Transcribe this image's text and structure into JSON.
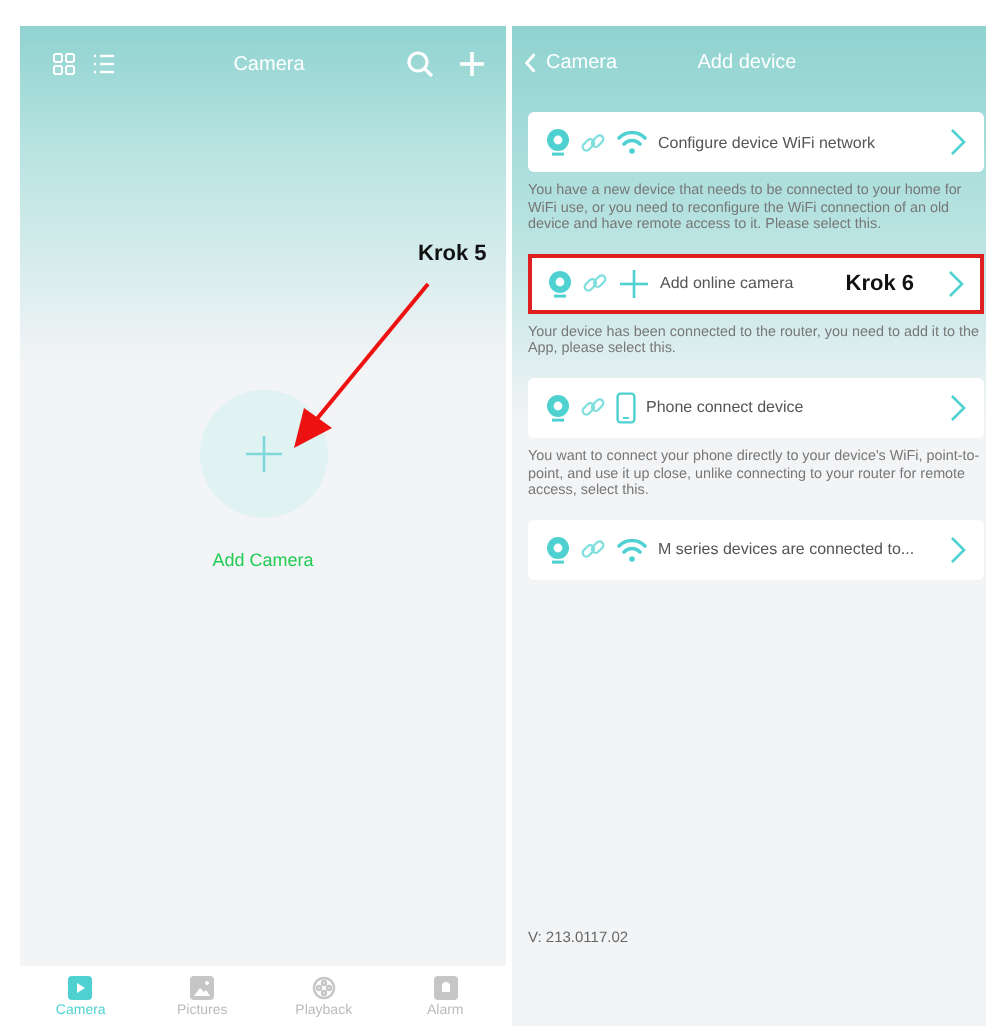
{
  "left_screen": {
    "header": {
      "title": "Camera"
    },
    "add_button": {
      "label": "Add Camera"
    },
    "annotation": {
      "label": "Krok 5"
    },
    "tab_bar": [
      {
        "label": "Camera",
        "kind": "play",
        "selected": true
      },
      {
        "label": "Pictures",
        "kind": "picture",
        "selected": false
      },
      {
        "label": "Playback",
        "kind": "reel",
        "selected": false
      },
      {
        "label": "Alarm",
        "kind": "bell",
        "selected": false
      }
    ]
  },
  "right_screen": {
    "header": {
      "back": "Camera",
      "title": "Add device"
    },
    "options": [
      {
        "kind": "wifi",
        "label": "Configure device WiFi network",
        "highlighted": false,
        "description": "You have a new device that needs to be connected to your home for WiFi use, or you need to reconfigure the WiFi connection of an old device and have remote access to it. Please select this."
      },
      {
        "kind": "plus",
        "label": "Add online camera",
        "highlighted": true,
        "annotation": "Krok 6",
        "description": "Your device has been connected to the router, you need to add it to the App, please select this."
      },
      {
        "kind": "phone",
        "label": "Phone connect device",
        "highlighted": false,
        "description": "You want to connect your phone directly to your device's WiFi, point-to-point, and use it up close, unlike connecting to your router for remote access, select this."
      },
      {
        "kind": "wifi",
        "label": "M series devices are connected to...",
        "highlighted": false
      }
    ],
    "version": "V: 213.0117.02"
  }
}
